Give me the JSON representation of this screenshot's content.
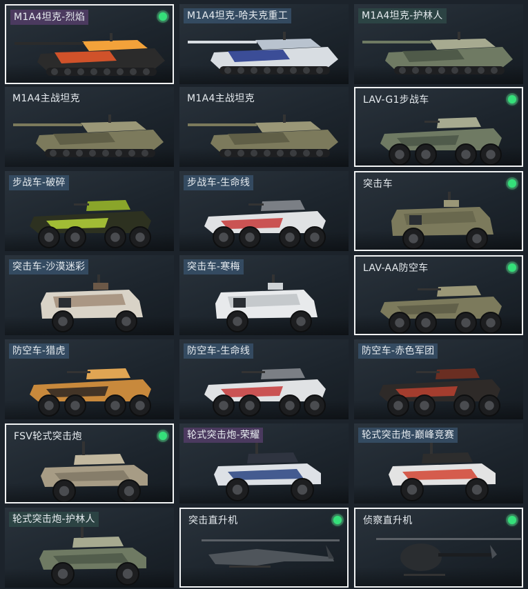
{
  "colors": {
    "equipped_indicator": "#35e07a",
    "selected_border": "#f2f4f5",
    "card_background": "#1d252d"
  },
  "vehicles": [
    {
      "name": "M1A4坦克-烈焰",
      "type": "tank",
      "skin": "flame",
      "equipped": true,
      "selected": true,
      "label_style": "rare-purple"
    },
    {
      "name": "M1A4坦克-哈夫克重工",
      "type": "tank",
      "skin": "blue",
      "equipped": false,
      "selected": false,
      "label_style": "rare-blue"
    },
    {
      "name": "M1A4坦克-护林人",
      "type": "tank",
      "skin": "camo",
      "equipped": false,
      "selected": false,
      "label_style": "rare-teal"
    },
    {
      "name": "M1A4主战坦克",
      "type": "tank",
      "skin": "olive",
      "equipped": false,
      "selected": false,
      "label_style": "plain"
    },
    {
      "name": "M1A4主战坦克",
      "type": "tank",
      "skin": "olive",
      "equipped": false,
      "selected": false,
      "label_style": "plain"
    },
    {
      "name": "LAV-G1步战车",
      "type": "ifv",
      "skin": "camo",
      "equipped": true,
      "selected": true,
      "label_style": "plain"
    },
    {
      "name": "步战车-破碎",
      "type": "ifv",
      "skin": "lime",
      "equipped": false,
      "selected": false,
      "label_style": "rare-blue"
    },
    {
      "name": "步战车-生命线",
      "type": "ifv",
      "skin": "lifeline",
      "equipped": false,
      "selected": false,
      "label_style": "rare-blue"
    },
    {
      "name": "突击车",
      "type": "assault",
      "skin": "olive",
      "equipped": true,
      "selected": true,
      "label_style": "plain"
    },
    {
      "name": "突击车-沙漠迷彩",
      "type": "assault",
      "skin": "desert",
      "equipped": false,
      "selected": false,
      "label_style": "rare-blue"
    },
    {
      "name": "突击车-寒梅",
      "type": "assault",
      "skin": "white",
      "equipped": false,
      "selected": false,
      "label_style": "rare-blue"
    },
    {
      "name": "LAV-AA防空车",
      "type": "aa",
      "skin": "olive",
      "equipped": true,
      "selected": true,
      "label_style": "plain"
    },
    {
      "name": "防空车-猎虎",
      "type": "aa",
      "skin": "tiger",
      "equipped": false,
      "selected": false,
      "label_style": "rare-blue"
    },
    {
      "name": "防空车-生命线",
      "type": "aa",
      "skin": "lifeline",
      "equipped": false,
      "selected": false,
      "label_style": "rare-blue"
    },
    {
      "name": "防空车-赤色军团",
      "type": "aa",
      "skin": "red",
      "equipped": false,
      "selected": false,
      "label_style": "rare-blue"
    },
    {
      "name": "FSV轮式突击炮",
      "type": "fsv",
      "skin": "tan",
      "equipped": true,
      "selected": true,
      "label_style": "plain"
    },
    {
      "name": "轮式突击炮-荣耀",
      "type": "fsv",
      "skin": "navy",
      "equipped": false,
      "selected": false,
      "label_style": "rare-purple"
    },
    {
      "name": "轮式突击炮-巅峰竞赛",
      "type": "fsv",
      "skin": "race",
      "equipped": false,
      "selected": false,
      "label_style": "rare-blue"
    },
    {
      "name": "轮式突击炮-护林人",
      "type": "fsv",
      "skin": "camo",
      "equipped": false,
      "selected": false,
      "label_style": "rare-teal"
    },
    {
      "name": "突击直升机",
      "type": "attack_heli",
      "skin": "gray",
      "equipped": true,
      "selected": true,
      "label_style": "plain"
    },
    {
      "name": "侦察直升机",
      "type": "scout_heli",
      "skin": "black",
      "equipped": true,
      "selected": true,
      "label_style": "plain"
    }
  ]
}
